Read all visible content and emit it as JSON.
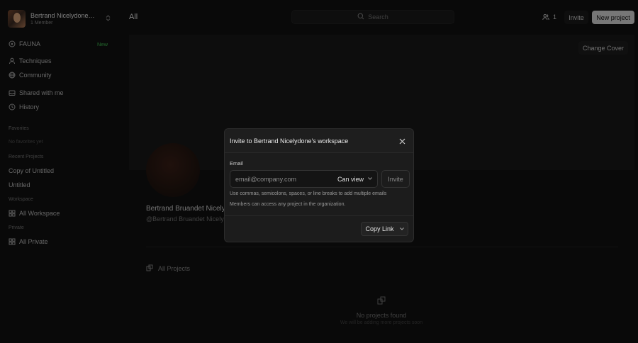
{
  "workspace": {
    "name": "Bertrand Nicelydone's ...",
    "members": "1 Member"
  },
  "sidebar": {
    "fauna": {
      "label": "FAUNA",
      "badge": "New"
    },
    "techniques": "Techniques",
    "community": "Community",
    "shared": "Shared with me",
    "history": "History",
    "favorites_label": "Favorites",
    "favorites_empty": "No favorites yet",
    "recent_label": "Recent Projects",
    "recent": [
      "Copy of Untitled",
      "Untitled"
    ],
    "workspace_label": "Workspace",
    "all_workspace": "All Workspace",
    "private_label": "Private",
    "all_private": "All Private"
  },
  "topbar": {
    "title": "All",
    "search_placeholder": "Search",
    "members_count": "1",
    "invite_label": "Invite",
    "new_project_label": "New project"
  },
  "cover": {
    "change_label": "Change Cover"
  },
  "profile": {
    "name": "Bertrand Bruandet Nicelydone",
    "handle": "@Bertrand Bruandet Nicelydone"
  },
  "projects": {
    "all_label": "All Projects",
    "empty_title": "No projects found",
    "empty_sub": "We will be adding more projects soon"
  },
  "modal": {
    "title": "Invite to Bertrand Nicelydone's workspace",
    "email_label": "Email",
    "email_placeholder": "email@company.com",
    "permission": "Can view",
    "invite_label": "Invite",
    "hint1": "Use commas, semicolons, spaces, or line breaks to add multiple emails",
    "hint2": "Members can access any project in the organization.",
    "copy_link_label": "Copy Link"
  }
}
